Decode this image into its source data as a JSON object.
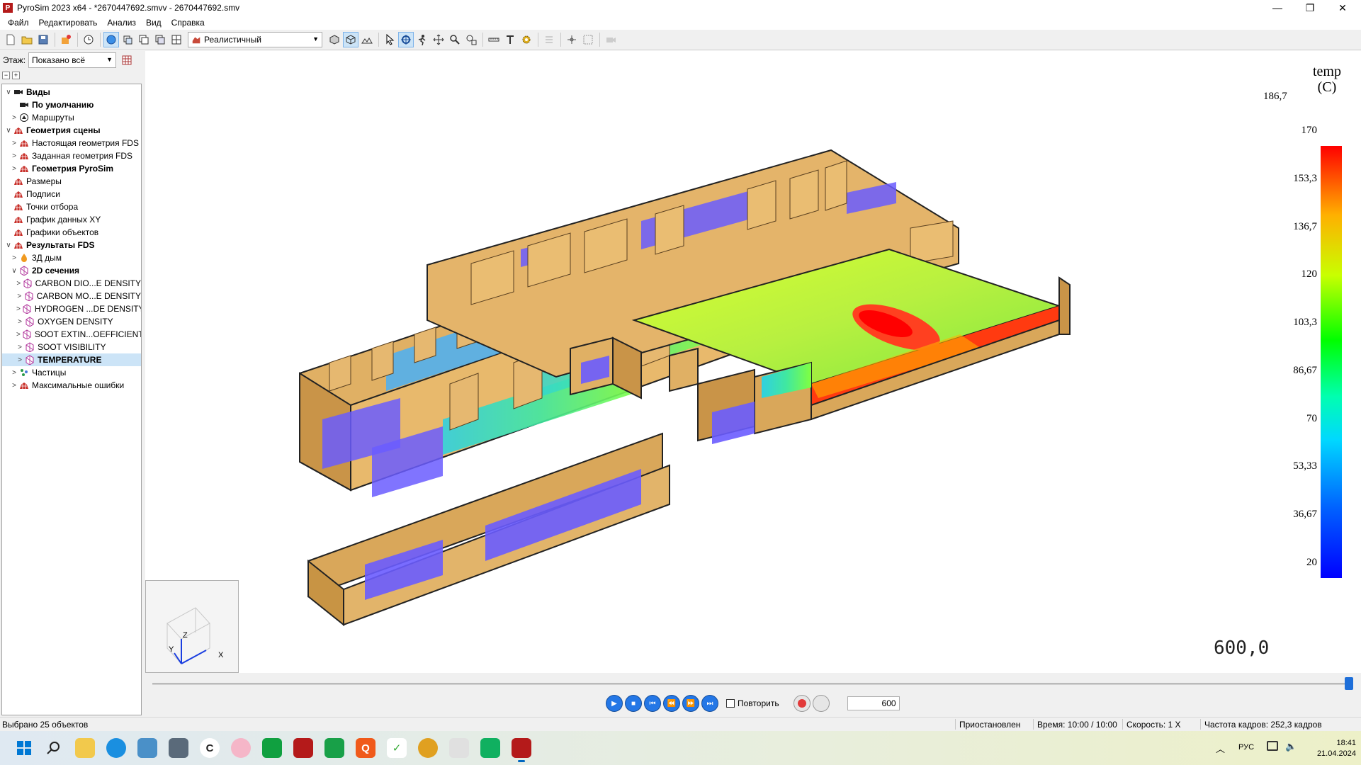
{
  "window": {
    "title": "PyroSim 2023 x64 - *2670447692.smvv - 2670447692.smv",
    "app_icon_letter": "P",
    "controls": [
      "minimize-icon",
      "maximize-icon",
      "close-icon"
    ],
    "minimize": "—",
    "maximize": "❐",
    "close": "✕"
  },
  "menu": [
    "Файл",
    "Редактировать",
    "Анализ",
    "Вид",
    "Справка"
  ],
  "toolbar": {
    "render_mode": "Реалистичный"
  },
  "floor": {
    "label": "Этаж:",
    "value": "Показано всё"
  },
  "tree": {
    "collapse_all": "−",
    "expand_all": "+",
    "nodes": [
      {
        "level": 0,
        "chev": "∨",
        "icon": "camera-icon",
        "label": "Виды",
        "bold": true
      },
      {
        "level": 1,
        "chev": "",
        "icon": "camera-icon",
        "label": "По умолчанию",
        "bold": true
      },
      {
        "level": 1,
        "chev": ">",
        "icon": "route-icon",
        "label": "Маршруты",
        "bold": false
      },
      {
        "level": 0,
        "chev": "∨",
        "icon": "geometry-icon",
        "label": "Геометрия сцены",
        "bold": true
      },
      {
        "level": 1,
        "chev": ">",
        "icon": "geometry-icon",
        "label": "Настоящая геометрия FDS",
        "bold": false
      },
      {
        "level": 1,
        "chev": ">",
        "icon": "geometry-icon",
        "label": "Заданная геометрия FDS",
        "bold": false
      },
      {
        "level": 1,
        "chev": ">",
        "icon": "geometry-icon",
        "label": "Геометрия PyroSim",
        "bold": true
      },
      {
        "level": 0,
        "chev": "",
        "icon": "geometry-icon",
        "label": "Размеры",
        "bold": false
      },
      {
        "level": 0,
        "chev": "",
        "icon": "geometry-icon",
        "label": "Подписи",
        "bold": false
      },
      {
        "level": 0,
        "chev": "",
        "icon": "geometry-icon",
        "label": "Точки отбора",
        "bold": false
      },
      {
        "level": 0,
        "chev": "",
        "icon": "geometry-icon",
        "label": "График данных XY",
        "bold": false
      },
      {
        "level": 0,
        "chev": "",
        "icon": "geometry-icon",
        "label": "Графики объектов",
        "bold": false
      },
      {
        "level": 0,
        "chev": "∨",
        "icon": "geometry-icon",
        "label": "Результаты FDS",
        "bold": true
      },
      {
        "level": 1,
        "chev": ">",
        "icon": "smoke-icon",
        "label": "3Д дым",
        "bold": false
      },
      {
        "level": 1,
        "chev": "∨",
        "icon": "slice-icon",
        "label": "2D сечения",
        "bold": true
      },
      {
        "level": 2,
        "chev": ">",
        "icon": "slice-icon",
        "label": "CARBON DIO...E DENSITY",
        "bold": false
      },
      {
        "level": 2,
        "chev": ">",
        "icon": "slice-icon",
        "label": "CARBON MO...E DENSITY",
        "bold": false
      },
      {
        "level": 2,
        "chev": ">",
        "icon": "slice-icon",
        "label": "HYDROGEN ...DE DENSITY",
        "bold": false
      },
      {
        "level": 2,
        "chev": ">",
        "icon": "slice-icon",
        "label": "OXYGEN DENSITY",
        "bold": false
      },
      {
        "level": 2,
        "chev": ">",
        "icon": "slice-icon",
        "label": "SOOT EXTIN...OEFFICIENT",
        "bold": false
      },
      {
        "level": 2,
        "chev": ">",
        "icon": "slice-icon",
        "label": "SOOT VISIBILITY",
        "bold": false
      },
      {
        "level": 2,
        "chev": ">",
        "icon": "slice-icon",
        "label": "TEMPERATURE",
        "bold": false,
        "selected": true
      },
      {
        "level": 1,
        "chev": ">",
        "icon": "particles-icon",
        "label": "Частицы",
        "bold": false
      },
      {
        "level": 1,
        "chev": ">",
        "icon": "geometry-icon",
        "label": "Максимальные ошибки",
        "bold": false
      }
    ]
  },
  "axes": {
    "x": "X",
    "y": "Y",
    "z": "Z"
  },
  "colorbar": {
    "title": "temp",
    "unit": "(C)",
    "max_value": "186,7",
    "labels": [
      "170",
      "153,3",
      "136,7",
      "120",
      "103,3",
      "86,67",
      "70",
      "53,33",
      "36,67",
      "20"
    ],
    "colors": {
      "hot": "#ff0000",
      "mid": "#00ff00",
      "cold": "#0000ff"
    }
  },
  "time_display": "600,0",
  "playback": {
    "repeat_label": "Повторить",
    "frame_value": "600",
    "slider_fraction": 1.0
  },
  "status": {
    "selection": "Выбрано 25 объектов",
    "state": "Приостановлен",
    "time": "Время: 10:00 / 10:00",
    "speed": "Скорость: 1 X",
    "fps": "Частота кадров: 252,3 кадров"
  },
  "taskbar": {
    "lang": "РУС",
    "clock": "18:41",
    "date": "21.04.2024"
  }
}
